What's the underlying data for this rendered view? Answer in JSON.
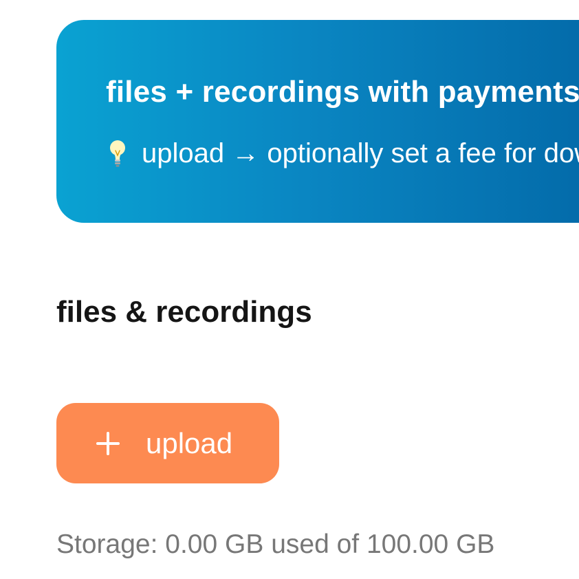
{
  "banner": {
    "title": "files + recordings with payments",
    "hint": "upload → optionally set a fee for download",
    "hint_icon": "lightbulb-icon"
  },
  "section": {
    "title": "files & recordings"
  },
  "upload_button": {
    "label": "upload",
    "icon": "plus-icon"
  },
  "storage": {
    "text": "Storage: 0.00 GB used of 100.00 GB"
  },
  "colors": {
    "banner_start": "#0aa2d2",
    "banner_end": "#0369a8",
    "button": "#fd8a51",
    "storage_text": "#777777"
  }
}
